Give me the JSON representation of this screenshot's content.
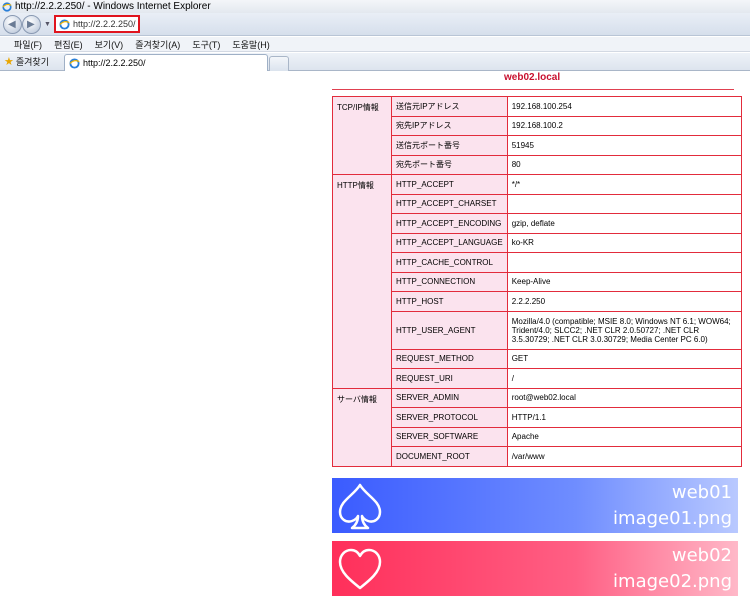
{
  "window": {
    "title": "http://2.2.2.250/ - Windows Internet Explorer"
  },
  "address": {
    "url": "http://2.2.2.250/"
  },
  "menu": [
    "파일(F)",
    "편집(E)",
    "보기(V)",
    "즐겨찾기(A)",
    "도구(T)",
    "도움말(H)"
  ],
  "favorites": {
    "label": "즐겨찾기"
  },
  "tab": {
    "title": "http://2.2.2.250/"
  },
  "page": {
    "hostname": "web02.local",
    "sections": [
      {
        "category": "TCP/IP情報",
        "rows": [
          {
            "key": "送信元IPアドレス",
            "value": "192.168.100.254"
          },
          {
            "key": "宛先IPアドレス",
            "value": "192.168.100.2"
          },
          {
            "key": "送信元ポート番号",
            "value": "51945"
          },
          {
            "key": "宛先ポート番号",
            "value": "80"
          }
        ]
      },
      {
        "category": "HTTP情報",
        "rows": [
          {
            "key": "HTTP_ACCEPT",
            "value": "*/*"
          },
          {
            "key": "HTTP_ACCEPT_CHARSET",
            "value": ""
          },
          {
            "key": "HTTP_ACCEPT_ENCODING",
            "value": "gzip, deflate"
          },
          {
            "key": "HTTP_ACCEPT_LANGUAGE",
            "value": "ko-KR"
          },
          {
            "key": "HTTP_CACHE_CONTROL",
            "value": ""
          },
          {
            "key": "HTTP_CONNECTION",
            "value": "Keep-Alive"
          },
          {
            "key": "HTTP_HOST",
            "value": "2.2.2.250"
          },
          {
            "key": "HTTP_USER_AGENT",
            "value": "Mozilla/4.0 (compatible; MSIE 8.0; Windows NT 6.1; WOW64; Trident/4.0; SLCC2; .NET CLR 2.0.50727; .NET CLR 3.5.30729; .NET CLR 3.0.30729; Media Center PC 6.0)",
            "tall": true
          },
          {
            "key": "REQUEST_METHOD",
            "value": "GET"
          },
          {
            "key": "REQUEST_URI",
            "value": "/"
          }
        ]
      },
      {
        "category": "サーバ情報",
        "rows": [
          {
            "key": "SERVER_ADMIN",
            "value": "root@web02.local"
          },
          {
            "key": "SERVER_PROTOCOL",
            "value": "HTTP/1.1"
          },
          {
            "key": "SERVER_SOFTWARE",
            "value": "Apache"
          },
          {
            "key": "DOCUMENT_ROOT",
            "value": "/var/www"
          }
        ]
      }
    ]
  },
  "banners": [
    {
      "icon": "spade-icon",
      "line1": "web01",
      "line2": "image01.png",
      "color": "#3a5bff"
    },
    {
      "icon": "heart-icon",
      "line1": "web02",
      "line2": "image02.png",
      "color": "#ff2f5a"
    }
  ]
}
